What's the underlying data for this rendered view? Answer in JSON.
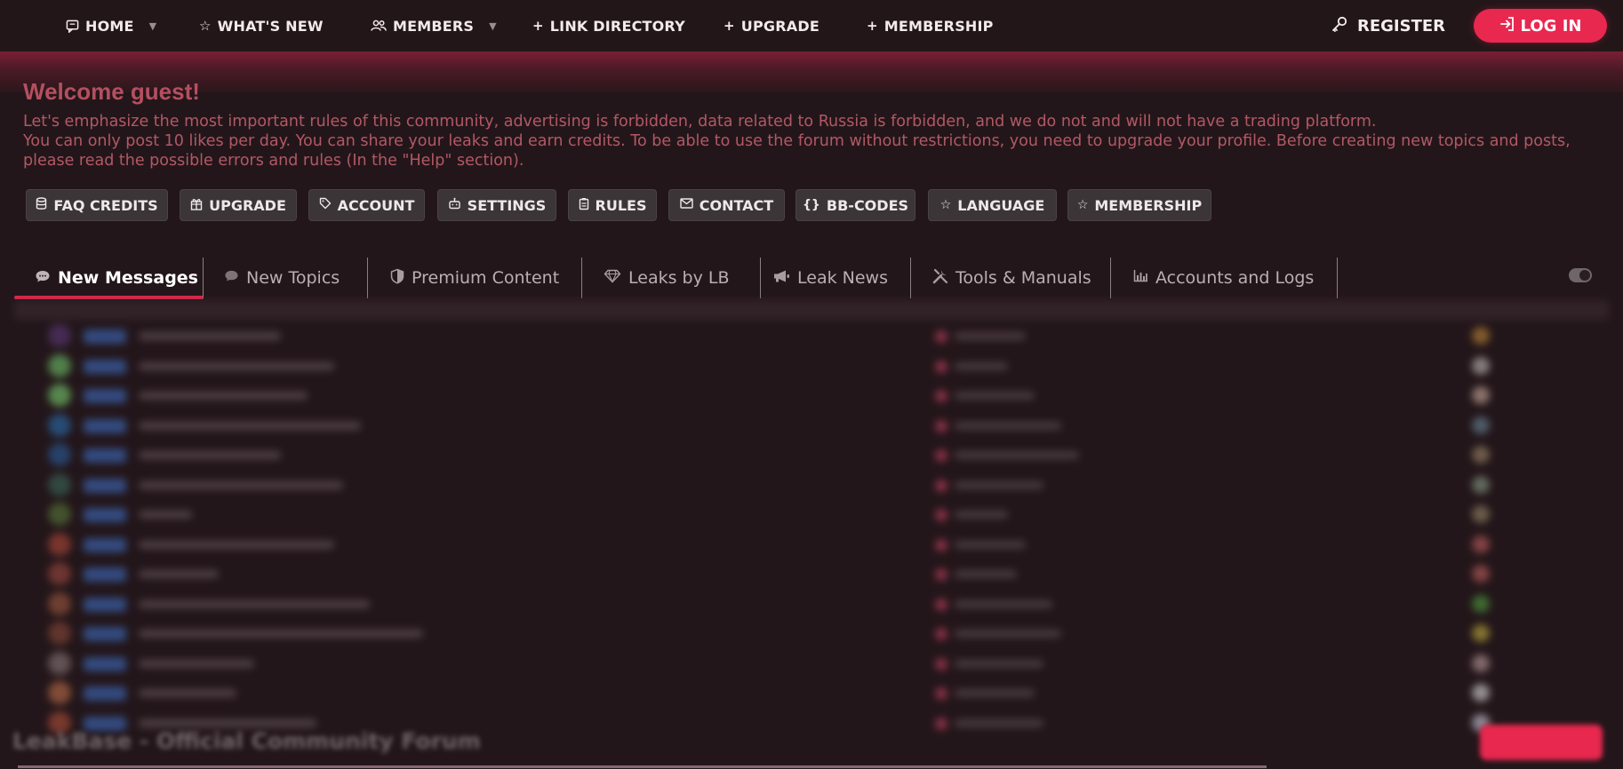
{
  "nav": {
    "items": [
      {
        "label": "HOME",
        "icon": "message-square-icon",
        "dropdown": true
      },
      {
        "label": "WHAT'S NEW",
        "icon": "star-icon",
        "dropdown": false
      },
      {
        "label": "MEMBERS",
        "icon": "users-icon",
        "dropdown": true
      },
      {
        "label": "LINK DIRECTORY",
        "icon": "plus-icon",
        "dropdown": false
      },
      {
        "label": "UPGRADE",
        "icon": "plus-icon",
        "dropdown": false
      },
      {
        "label": "MEMBERSHIP",
        "icon": "plus-icon",
        "dropdown": false
      }
    ],
    "register_label": "REGISTER",
    "login_label": "LOG IN"
  },
  "welcome": {
    "title": "Welcome guest!",
    "lines": [
      "Let's emphasize the most important rules of this community, advertising is forbidden, data related to Russia is forbidden, and we do not and will not have a trading platform.",
      "You can only post 10 likes per day. You can share your leaks and earn credits. To be able to use the forum without restrictions, you need to upgrade your profile. Before creating new topics and posts,",
      "please read the possible errors and rules (In the \"Help\" section)."
    ]
  },
  "quick_buttons": [
    {
      "label": "FAQ CREDITS",
      "icon": "database-icon"
    },
    {
      "label": "UPGRADE",
      "icon": "gift-icon"
    },
    {
      "label": "ACCOUNT",
      "icon": "tag-icon"
    },
    {
      "label": "SETTINGS",
      "icon": "robot-icon"
    },
    {
      "label": "RULES",
      "icon": "clipboard-icon"
    },
    {
      "label": "CONTACT",
      "icon": "mail-icon"
    },
    {
      "label": "BB-CODES",
      "icon": "braces-icon"
    },
    {
      "label": "LANGUAGE",
      "icon": "star-icon"
    },
    {
      "label": "MEMBERSHIP",
      "icon": "star-icon"
    }
  ],
  "tabs": [
    {
      "label": "New Messages",
      "icon": "chat-bubble-icon",
      "active": true
    },
    {
      "label": "New Topics",
      "icon": "chat-bubble-icon",
      "active": false
    },
    {
      "label": "Premium Content",
      "icon": "shield-icon",
      "active": false
    },
    {
      "label": "Leaks by LB",
      "icon": "diamond-icon",
      "active": false
    },
    {
      "label": "Leak News",
      "icon": "megaphone-icon",
      "active": false
    },
    {
      "label": "Tools & Manuals",
      "icon": "tools-icon",
      "active": false
    },
    {
      "label": "Accounts and Logs",
      "icon": "bar-chart-icon",
      "active": false
    }
  ],
  "colors": {
    "accent": "#e8284f",
    "background": "#23161a",
    "welcome_text": "#b25865",
    "button_bg": "#3b3538"
  },
  "footer": {
    "title": "LeakBase - Official Community Forum"
  }
}
